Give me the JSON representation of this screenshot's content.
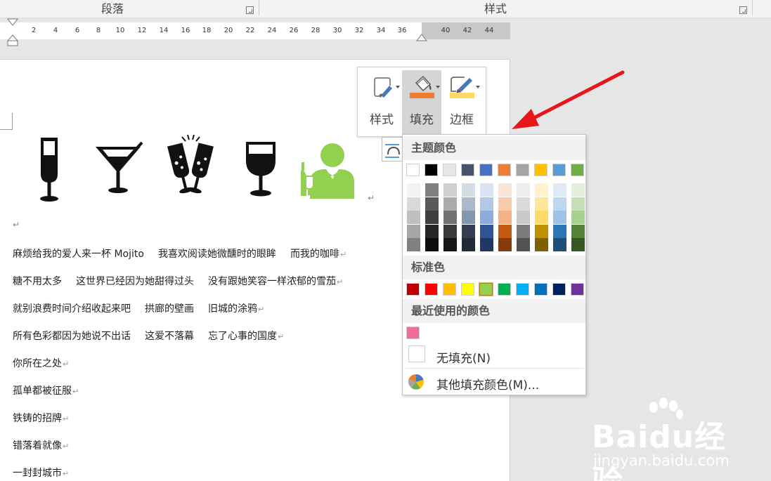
{
  "ribbon": {
    "group_paragraph": "段落",
    "group_styles": "样式"
  },
  "ruler": {
    "ticks": [
      "2",
      "4",
      "6",
      "8",
      "10",
      "12",
      "14",
      "16",
      "18",
      "20",
      "22",
      "24",
      "26",
      "28",
      "30",
      "32",
      "34",
      "36",
      "40",
      "42",
      "44"
    ]
  },
  "document": {
    "lines": [
      [
        "麻烦给我的爱人来一杯 Mojito",
        "我喜欢阅读她微醺时的眼眸",
        "而我的咖啡"
      ],
      [
        "糖不用太多",
        "这世界已经因为她甜得过头",
        "没有跟她笑容一样浓郁的雪茄"
      ],
      [
        "就别浪费时间介绍收起来吧",
        "拱廊的壁画",
        "旧城的涂鸦"
      ],
      [
        "所有色彩都因为她说不出话",
        "这爱不落幕",
        "忘了心事的国度"
      ],
      [
        "你所在之处"
      ],
      [
        "孤单都被征服"
      ],
      [
        "铁铸的招牌"
      ],
      [
        "错落着就像"
      ],
      [
        "一封封城市"
      ]
    ],
    "para_mark": "↵"
  },
  "toolbar": {
    "style_label": "样式",
    "fill_label": "填充",
    "border_label": "边框"
  },
  "fill_menu": {
    "theme_colors_title": "主题颜色",
    "standard_colors_title": "标准色",
    "recent_colors_title": "最近使用的颜色",
    "no_fill_label": "无填充(N)",
    "more_colors_label": "其他填充颜色(M)...",
    "theme_top": [
      "#ffffff",
      "#000000",
      "#e7e6e6",
      "#44546a",
      "#4472c4",
      "#ed7d31",
      "#a5a5a5",
      "#ffc000",
      "#5b9bd5",
      "#70ad47"
    ],
    "theme_shades": [
      [
        "#f2f2f2",
        "#d9d9d9",
        "#bfbfbf",
        "#a6a6a6",
        "#808080"
      ],
      [
        "#808080",
        "#595959",
        "#404040",
        "#262626",
        "#0d0d0d"
      ],
      [
        "#d0cece",
        "#aeaaaa",
        "#757171",
        "#3a3838",
        "#171616"
      ],
      [
        "#d6dce5",
        "#adb9ca",
        "#8497b0",
        "#333f50",
        "#222a35"
      ],
      [
        "#dae3f3",
        "#b4c7e7",
        "#8faadc",
        "#2f5597",
        "#203864"
      ],
      [
        "#fbe5d6",
        "#f8cbad",
        "#f4b183",
        "#c55a11",
        "#843c0c"
      ],
      [
        "#ededed",
        "#dbdbdb",
        "#c9c9c9",
        "#7b7b7b",
        "#525252"
      ],
      [
        "#fff2cc",
        "#ffe699",
        "#ffd966",
        "#bf9000",
        "#7f6000"
      ],
      [
        "#deebf7",
        "#bdd7ee",
        "#9dc3e6",
        "#2e75b6",
        "#1f4e79"
      ],
      [
        "#e2f0d9",
        "#c5e0b4",
        "#a9d18e",
        "#538135",
        "#375623"
      ]
    ],
    "standard": [
      "#c00000",
      "#ff0000",
      "#ffc000",
      "#ffff00",
      "#92d050",
      "#00b050",
      "#00b0f0",
      "#0070c0",
      "#002060",
      "#7030a0"
    ],
    "standard_selected_index": 4,
    "recent": [
      "#f06c9b"
    ]
  },
  "watermark": {
    "brand": "Baidu经验",
    "url": "jingyan.baidu.com"
  },
  "colors": {
    "fill_orange": "#ed7d31",
    "border_yellow": "#ffd966",
    "arrow_red": "#e8161b",
    "bartender_green": "#92d050"
  }
}
